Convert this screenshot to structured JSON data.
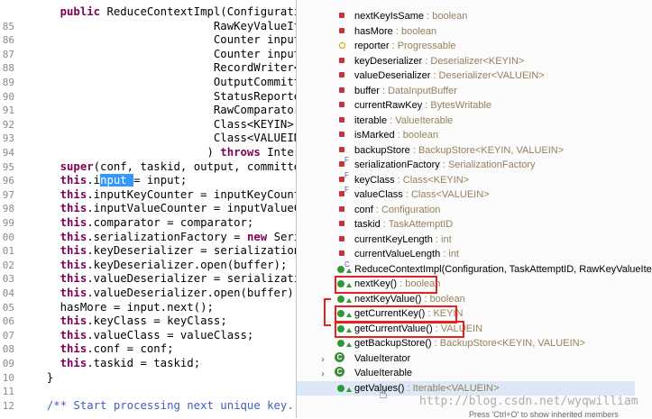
{
  "editor": {
    "lines": [
      {
        "num": "",
        "segments": [
          {
            "t": "    public ",
            "c": "kw"
          },
          {
            "t": "ReduceContextImpl(Configuration",
            "c": ""
          }
        ]
      },
      {
        "num": "85",
        "segments": [
          {
            "t": "                           RawKeyValueIte",
            "c": ""
          }
        ]
      },
      {
        "num": "86",
        "segments": [
          {
            "t": "                           Counter inputK",
            "c": ""
          }
        ]
      },
      {
        "num": "87",
        "segments": [
          {
            "t": "                           Counter inputV",
            "c": ""
          }
        ]
      },
      {
        "num": "88",
        "segments": [
          {
            "t": "                           RecordWriter<K",
            "c": ""
          }
        ]
      },
      {
        "num": "89",
        "segments": [
          {
            "t": "                           OutputCommitte",
            "c": ""
          }
        ]
      },
      {
        "num": "90",
        "segments": [
          {
            "t": "                           StatusReporter",
            "c": ""
          }
        ]
      },
      {
        "num": "91",
        "segments": [
          {
            "t": "                           RawComparator<",
            "c": ""
          }
        ]
      },
      {
        "num": "92",
        "segments": [
          {
            "t": "                           Class<KEYIN> k",
            "c": ""
          }
        ]
      },
      {
        "num": "93",
        "segments": [
          {
            "t": "                           Class<VALUEIN>",
            "c": ""
          }
        ]
      },
      {
        "num": "94",
        "segments": [
          {
            "t": "                          ) ",
            "c": ""
          },
          {
            "t": "throws ",
            "c": "kw"
          },
          {
            "t": "Interr",
            "c": ""
          }
        ]
      },
      {
        "num": "95",
        "segments": [
          {
            "t": "    ",
            "c": ""
          },
          {
            "t": "super",
            "c": "kw"
          },
          {
            "t": "(conf, taskid, output, committer",
            "c": ""
          }
        ]
      },
      {
        "num": "96",
        "segments": [
          {
            "t": "    ",
            "c": ""
          },
          {
            "t": "this",
            "c": "kw"
          },
          {
            "t": ".i",
            "c": ""
          },
          {
            "t": "nput ",
            "c": "hl"
          },
          {
            "t": "= input;",
            "c": ""
          }
        ]
      },
      {
        "num": "97",
        "segments": [
          {
            "t": "    ",
            "c": ""
          },
          {
            "t": "this",
            "c": "kw"
          },
          {
            "t": ".inputKeyCounter = inputKeyCounte",
            "c": ""
          }
        ]
      },
      {
        "num": "98",
        "segments": [
          {
            "t": "    ",
            "c": ""
          },
          {
            "t": "this",
            "c": "kw"
          },
          {
            "t": ".inputValueCounter = inputValueCo",
            "c": ""
          }
        ]
      },
      {
        "num": "99",
        "segments": [
          {
            "t": "    ",
            "c": ""
          },
          {
            "t": "this",
            "c": "kw"
          },
          {
            "t": ".comparator = comparator;",
            "c": ""
          }
        ]
      },
      {
        "num": "00",
        "segments": [
          {
            "t": "    ",
            "c": ""
          },
          {
            "t": "this",
            "c": "kw"
          },
          {
            "t": ".serializationFactory = ",
            "c": ""
          },
          {
            "t": "new ",
            "c": "kw"
          },
          {
            "t": "Seria",
            "c": ""
          }
        ]
      },
      {
        "num": "01",
        "segments": [
          {
            "t": "    ",
            "c": ""
          },
          {
            "t": "this",
            "c": "kw"
          },
          {
            "t": ".keyDeserializer = serializationF",
            "c": ""
          }
        ]
      },
      {
        "num": "02",
        "segments": [
          {
            "t": "    ",
            "c": ""
          },
          {
            "t": "this",
            "c": "kw"
          },
          {
            "t": ".keyDeserializer.open(buffer);",
            "c": ""
          }
        ]
      },
      {
        "num": "03",
        "segments": [
          {
            "t": "    ",
            "c": ""
          },
          {
            "t": "this",
            "c": "kw"
          },
          {
            "t": ".valueDeserializer = serializatio",
            "c": ""
          }
        ]
      },
      {
        "num": "04",
        "segments": [
          {
            "t": "    ",
            "c": ""
          },
          {
            "t": "this",
            "c": "kw"
          },
          {
            "t": ".valueDeserializer.open(buffer);",
            "c": ""
          }
        ]
      },
      {
        "num": "05",
        "segments": [
          {
            "t": "    hasMore = input.next();",
            "c": ""
          }
        ]
      },
      {
        "num": "06",
        "segments": [
          {
            "t": "    ",
            "c": ""
          },
          {
            "t": "this",
            "c": "kw"
          },
          {
            "t": ".keyClass = keyClass;",
            "c": ""
          }
        ]
      },
      {
        "num": "07",
        "segments": [
          {
            "t": "    ",
            "c": ""
          },
          {
            "t": "this",
            "c": "kw"
          },
          {
            "t": ".valueClass = valueClass;",
            "c": ""
          }
        ]
      },
      {
        "num": "08",
        "segments": [
          {
            "t": "    ",
            "c": ""
          },
          {
            "t": "this",
            "c": "kw"
          },
          {
            "t": ".conf = conf;",
            "c": ""
          }
        ]
      },
      {
        "num": "09",
        "segments": [
          {
            "t": "    ",
            "c": ""
          },
          {
            "t": "this",
            "c": "kw"
          },
          {
            "t": ".taskid = taskid;",
            "c": ""
          }
        ]
      },
      {
        "num": "10",
        "segments": [
          {
            "t": "  }",
            "c": ""
          }
        ]
      },
      {
        "num": "11",
        "segments": [
          {
            "t": "",
            "c": ""
          }
        ]
      },
      {
        "num": "12",
        "segments": [
          {
            "t": "  ",
            "c": ""
          },
          {
            "t": "/** Start processing next unique key. *",
            "c": "cm"
          }
        ]
      }
    ]
  },
  "popup": {
    "items": [
      {
        "name": "nextKeyIsSame",
        "type": "boolean",
        "icon": "private-field-icon"
      },
      {
        "name": "hasMore",
        "type": "boolean",
        "icon": "private-field-icon"
      },
      {
        "name": "reporter",
        "type": "Progressable",
        "icon": "package-field-icon"
      },
      {
        "name": "keyDeserializer",
        "type": "Deserializer<KEYIN>",
        "icon": "private-field-icon"
      },
      {
        "name": "valueDeserializer",
        "type": "Deserializer<VALUEIN>",
        "icon": "private-field-icon"
      },
      {
        "name": "buffer",
        "type": "DataInputBuffer",
        "icon": "private-field-icon"
      },
      {
        "name": "currentRawKey",
        "type": "BytesWritable",
        "icon": "private-field-icon"
      },
      {
        "name": "iterable",
        "type": "ValueIterable",
        "icon": "private-field-icon"
      },
      {
        "name": "isMarked",
        "type": "boolean",
        "icon": "private-field-icon"
      },
      {
        "name": "backupStore",
        "type": "BackupStore<KEYIN, VALUEIN>",
        "icon": "private-field-icon"
      },
      {
        "name": "serializationFactory",
        "type": "SerializationFactory",
        "icon": "final-field-icon",
        "sup": "F"
      },
      {
        "name": "keyClass",
        "type": "Class<KEYIN>",
        "icon": "final-field-icon",
        "sup": "F"
      },
      {
        "name": "valueClass",
        "type": "Class<VALUEIN>",
        "icon": "final-field-icon",
        "sup": "F"
      },
      {
        "name": "conf",
        "type": "Configuration",
        "icon": "private-field-icon"
      },
      {
        "name": "taskid",
        "type": "TaskAttemptID",
        "icon": "private-field-icon"
      },
      {
        "name": "currentKeyLength",
        "type": "int",
        "icon": "private-field-icon"
      },
      {
        "name": "currentValueLength",
        "type": "int",
        "icon": "private-field-icon"
      },
      {
        "name": "ReduceContextImpl(Configuration, TaskAttemptID, RawKeyValueIte",
        "type": "",
        "icon": "constructor-icon",
        "sup": "C"
      },
      {
        "name": "nextKey()",
        "type": "boolean",
        "icon": "public-method-icon"
      },
      {
        "name": "nextKeyValue()",
        "type": "boolean",
        "icon": "public-method-icon"
      },
      {
        "name": "getCurrentKey()",
        "type": "KEYIN",
        "icon": "public-method-icon"
      },
      {
        "name": "getCurrentValue()",
        "type": "VALUEIN",
        "icon": "public-method-icon"
      },
      {
        "name": "getBackupStore()",
        "type": "BackupStore<KEYIN, VALUEIN>",
        "icon": "public-method-icon"
      },
      {
        "name": "ValueIterator",
        "type": "",
        "icon": "inner-class-icon",
        "expand": "›"
      },
      {
        "name": "ValueIterable",
        "type": "",
        "icon": "inner-class-icon",
        "expand": "›"
      },
      {
        "name": "getValues()",
        "type": "Iterable<VALUEIN>",
        "icon": "public-method-icon"
      }
    ],
    "separator": " : ",
    "hint": "Press 'Ctrl+O' to show inherited members"
  },
  "watermark": "http://blog.csdn.net/wyqwilliam",
  "colors": {
    "keyword": "#7f0055",
    "highlight": "#3399ff",
    "annotation_box": "#e82020",
    "type_text": "#95815e"
  }
}
